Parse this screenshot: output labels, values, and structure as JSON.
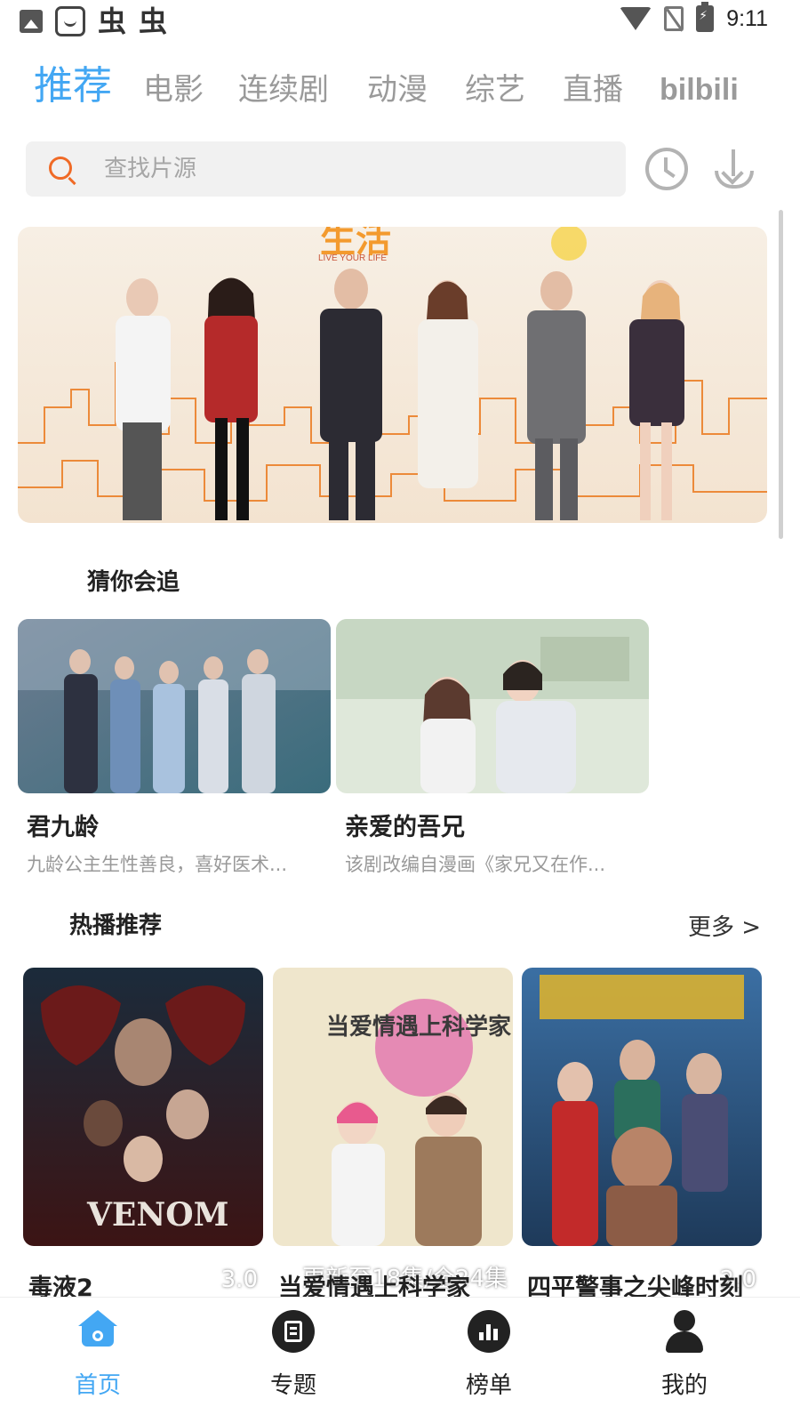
{
  "status_bar": {
    "left_glyph_1": "虫",
    "left_glyph_2": "虫",
    "time": "9:11"
  },
  "top_tabs": [
    {
      "label": "推荐",
      "active": true
    },
    {
      "label": "电影",
      "active": false
    },
    {
      "label": "连续剧",
      "active": false
    },
    {
      "label": "动漫",
      "active": false
    },
    {
      "label": "综艺",
      "active": false
    },
    {
      "label": "直播",
      "active": false
    },
    {
      "label": "bilbili",
      "active": false
    }
  ],
  "search": {
    "placeholder": "查找片源",
    "icon": "search-icon",
    "accent": "#f06a26"
  },
  "toolbar_icons": [
    "history-icon",
    "download-icon"
  ],
  "banner": {
    "poster_text": "LIVE YOUR LIFE"
  },
  "guess_section": {
    "title": "猜你会追",
    "items": [
      {
        "title": "君九龄",
        "desc": "九龄公主生性善良，喜好医术..."
      },
      {
        "title": "亲爱的吾兄",
        "desc": "该剧改编自漫画《家兄又在作..."
      }
    ]
  },
  "hot_section": {
    "title": "热播推荐",
    "more": "更多 >",
    "items": [
      {
        "title": "毒液2",
        "badge": "3.0",
        "poster_text": "VENOM"
      },
      {
        "title": "当爱情遇上科学家",
        "badge": "更新至18集/全24集",
        "poster_text": "当爱情遇上科学家"
      },
      {
        "title": "四平警事之尖峰时刻",
        "badge": "2.0",
        "poster_text": ""
      }
    ]
  },
  "bottom_nav": [
    {
      "label": "首页",
      "icon": "home-icon",
      "active": true
    },
    {
      "label": "专题",
      "icon": "topic-icon",
      "active": false
    },
    {
      "label": "榜单",
      "icon": "chart-icon",
      "active": false
    },
    {
      "label": "我的",
      "icon": "user-icon",
      "active": false
    }
  ],
  "colors": {
    "accent": "#43a7f3",
    "inactive_tab": "#9a9a9a",
    "search_bg": "#f1f1f1"
  }
}
